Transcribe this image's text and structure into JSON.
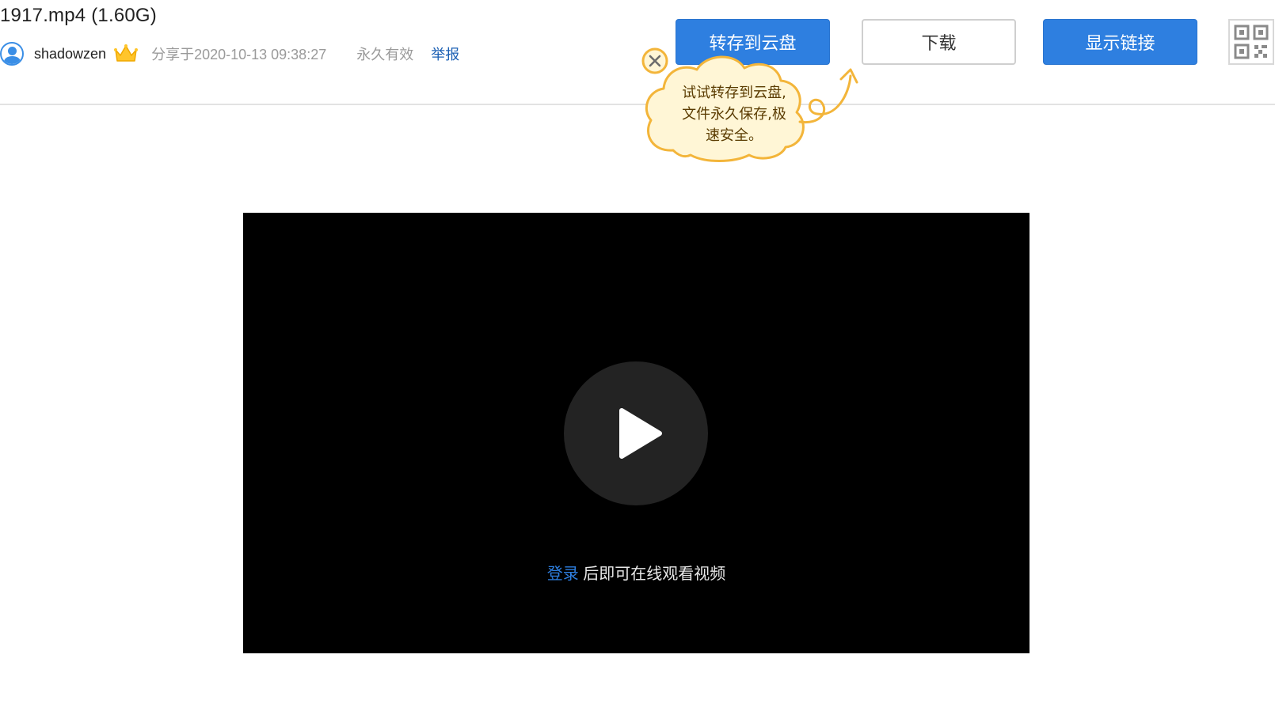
{
  "header": {
    "file_title": "1917.mp4 (1.60G)",
    "username": "shadowzen",
    "share_time": "分享于2020-10-13 09:38:27",
    "validity": "永久有效",
    "report_label": "举报"
  },
  "toolbar": {
    "save_label": "转存到云盘",
    "download_label": "下载",
    "show_link_label": "显示链接"
  },
  "tooltip": {
    "line1": "试试转存到云盘,",
    "line2": "文件永久保存,极",
    "line3": "速安全。"
  },
  "player": {
    "login_label": "登录",
    "login_suffix": " 后即可在线观看视频"
  },
  "colors": {
    "primary_button": "#2e7fe0",
    "link": "#1a5fb4",
    "tooltip_fill": "#fff6d6",
    "tooltip_border": "#f3b53a",
    "video_background": "#000000"
  },
  "icons": {
    "avatar": "user-avatar-icon",
    "vip": "crown-icon",
    "qr": "qr-code-icon",
    "close": "close-icon",
    "play": "play-icon"
  }
}
